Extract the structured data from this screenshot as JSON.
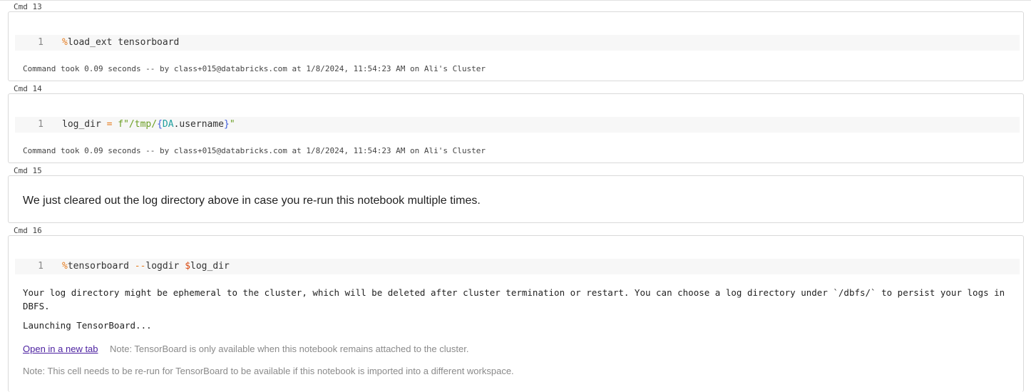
{
  "cells": [
    {
      "label": "Cmd 13",
      "line_no": "1",
      "magic": "%",
      "code": "load_ext tensorboard",
      "meta": "Command took 0.09 seconds -- by class+015@databricks.com at 1/8/2024, 11:54:23 AM on Ali's Cluster"
    },
    {
      "label": "Cmd 14",
      "line_no": "1",
      "code_var": "log_dir",
      "code_eq": "=",
      "code_fstr_open": "f\"/tmp/",
      "code_brace_open": "{",
      "code_obj": "DA",
      "code_attr": ".username",
      "code_brace_close": "}",
      "code_fstr_close": "\"",
      "meta": "Command took 0.09 seconds -- by class+015@databricks.com at 1/8/2024, 11:54:23 AM on Ali's Cluster"
    },
    {
      "label": "Cmd 15",
      "markdown": "We just cleared out the log directory above in case you re-run this notebook multiple times."
    },
    {
      "label": "Cmd 16",
      "line_no": "1",
      "magic": "%",
      "code_cmd": "tensorboard ",
      "code_flag": "--",
      "code_flag_name": "logdir ",
      "code_dollar": "$",
      "code_arg": "log_dir",
      "output_warning": "Your log directory might be ephemeral to the cluster, which will be deleted after cluster termination or restart. You can choose a log directory under `/dbfs/` to persist your logs in DBFS.",
      "output_launch": "Launching TensorBoard...",
      "link_text": "Open in a new tab",
      "note1": "Note: TensorBoard is only available when this notebook remains attached to the cluster.",
      "note2": "Note: This cell needs to be re-run for TensorBoard to be available if this notebook is imported into a different workspace."
    }
  ]
}
